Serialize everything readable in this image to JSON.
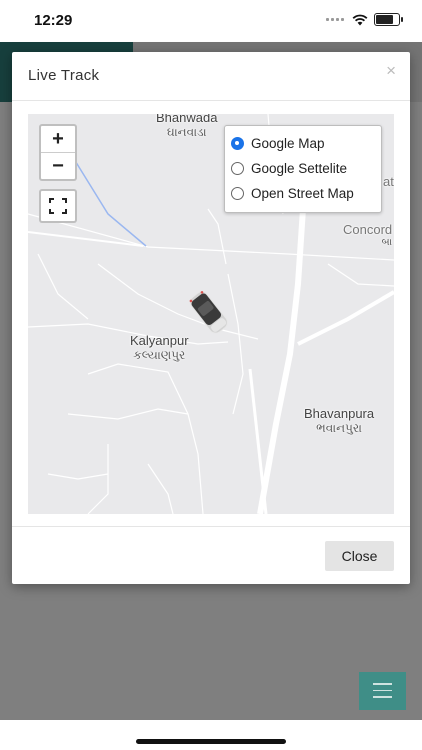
{
  "status_bar": {
    "time": "12:29"
  },
  "modal": {
    "title": "Live Track",
    "close_x": "×",
    "close_button_label": "Close"
  },
  "map": {
    "zoom_in": "+",
    "zoom_out": "−",
    "layers": [
      {
        "label": "Google Map",
        "selected": true
      },
      {
        "label": "Google Settelite",
        "selected": false
      },
      {
        "label": "Open Street Map",
        "selected": false
      }
    ],
    "places": {
      "top_name": "Bhanwada",
      "top_local": "ઘાનવાડા",
      "kalyanpur": "Kalyanpur",
      "kalyanpur_local": "કલ્યાણપુર",
      "bhavanpura": "Bhavanpura",
      "bhavanpura_local": "ભવાનપુરા",
      "concord": "Concord",
      "concord_local": "બા",
      "right_edge": "at"
    },
    "vehicle_icon": "car-icon"
  },
  "colors": {
    "accent_teal": "#2f7f7a",
    "radio_selected": "#1a73e8"
  }
}
